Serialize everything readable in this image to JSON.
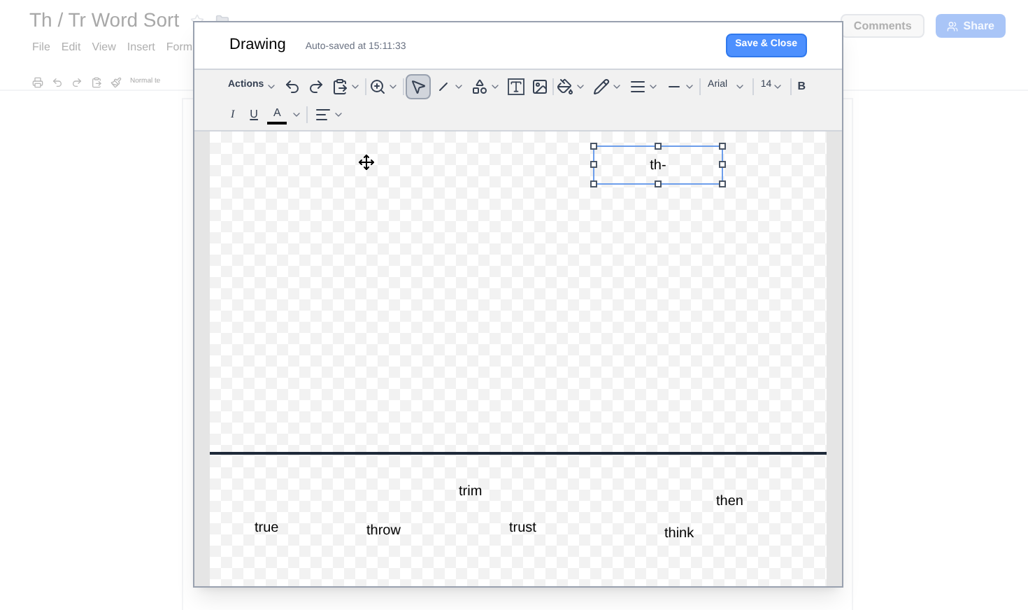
{
  "document": {
    "title": "Th / Tr Word Sort",
    "menu": [
      "File",
      "Edit",
      "View",
      "Insert",
      "Form"
    ],
    "style_select": "Normal te",
    "buttons": [
      {
        "label": "Comments",
        "kind": "plain"
      },
      {
        "label": "Share",
        "kind": "primary"
      }
    ]
  },
  "dialog": {
    "title": "Drawing",
    "status": "Auto-saved at 15:11:33",
    "save_button": "Save & Close",
    "toolbar": {
      "actions_menu": "Actions",
      "tools": [
        {
          "kind": "select",
          "selected": true
        },
        {
          "kind": "line",
          "selected": false
        }
      ],
      "font": "Arial",
      "font_size": "14",
      "bold": "B",
      "italic": "I",
      "underline": "U",
      "text_color": "A"
    },
    "canvas": {
      "selected_textbox": "th-",
      "words": [
        "trim",
        "then",
        "true",
        "throw",
        "trust",
        "think"
      ]
    }
  }
}
